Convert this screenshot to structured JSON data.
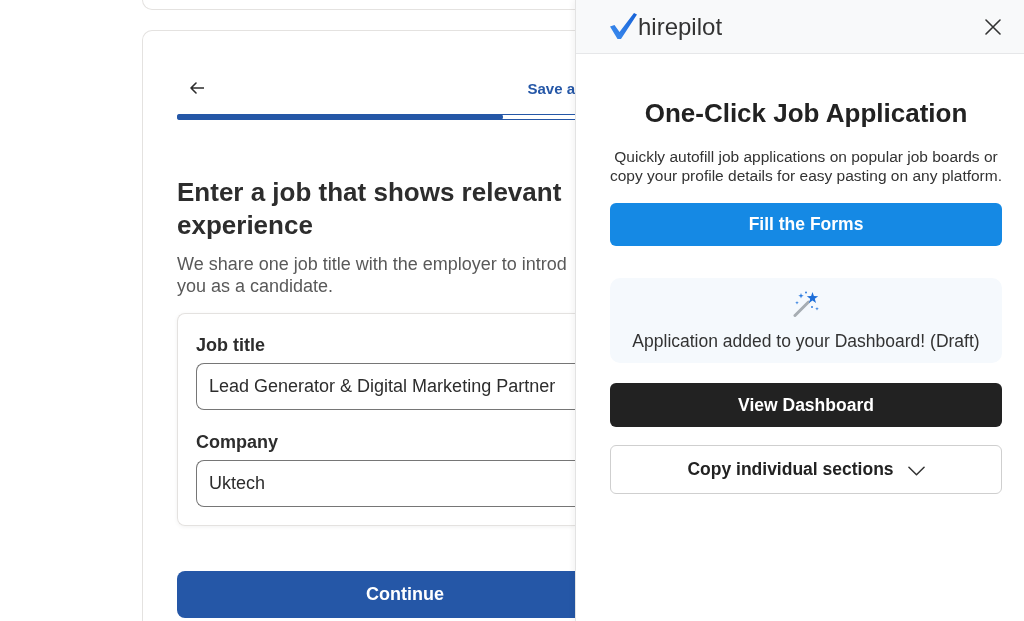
{
  "job_form": {
    "save_link": "Save a",
    "progress": {
      "level": 0.82
    },
    "heading": "Enter a job that shows relevant experience",
    "subtitle_lines": [
      "We share one job title with the employer to introd",
      "you as a candidate."
    ],
    "fields": [
      {
        "label": "Job title",
        "value": "Lead Generator & Digital Marketing Partner"
      },
      {
        "label": "Company",
        "value": "Uktech"
      }
    ],
    "continue_button": "Continue"
  },
  "extension_panel": {
    "logo_text": "hirepilot",
    "title": "One-Click Job Application",
    "description": "Quickly autofill job applications on popular job boards or copy your profile details for easy pasting on any platform.",
    "items": [
      {
        "kind": "primary",
        "label": "Fill the Forms"
      },
      {
        "kind": "notice",
        "text": "Application added to your Dashboard! (Draft)"
      },
      {
        "kind": "dark",
        "label": "View Dashboard"
      },
      {
        "kind": "dropdown",
        "label": "Copy individual sections"
      }
    ]
  }
}
